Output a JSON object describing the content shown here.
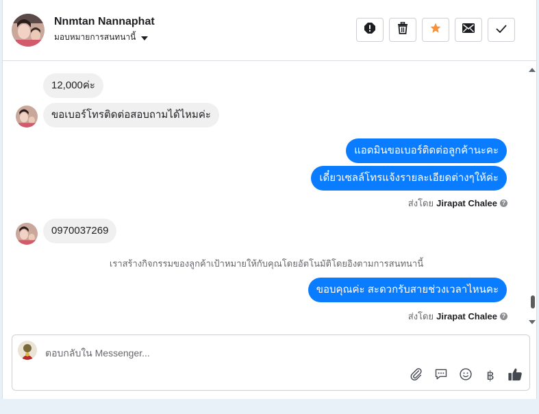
{
  "contact": {
    "name": "Nnmtan Nannaphat",
    "assign_label": "มอบหมายการสนทนานี้"
  },
  "header_actions": [
    "spam-icon",
    "trash-icon",
    "star-icon",
    "envelope-icon",
    "check-icon"
  ],
  "colors": {
    "outgoing_bubble": "#0a7cff",
    "incoming_bubble": "#f0f0f0",
    "star": "#f7923a"
  },
  "messages": {
    "m1": "12,000ค่ะ",
    "m2": "ขอเบอร์โทรติดต่อสอบถามได้ไหมค่ะ",
    "m3": "แอดมินขอเบอร์ติดต่อลูกค้านะคะ",
    "m4": "เดี๋ยวเซลล์โทรแจ้งรายละเอียดต่างๆให้ค่ะ",
    "m5": "0970037269",
    "m6": "ขอบคุณค่ะ สะดวกรับสายช่วงเวลาไหนคะ"
  },
  "sent_by": {
    "prefix": "ส่งโดย",
    "agent": "Jirapat Chalee"
  },
  "system_note": "เราสร้างกิจกรรมของลูกค้าเป้าหมายให้กับคุณโดยอัตโนมัติโดยอิงตามการสนทนานี้",
  "composer": {
    "placeholder": "ตอบกลับใน Messenger...",
    "tools": [
      "paperclip-icon",
      "saved-reply-icon",
      "emoji-icon",
      "baht-icon",
      "thumbs-up-icon"
    ],
    "baht_symbol": "฿"
  }
}
